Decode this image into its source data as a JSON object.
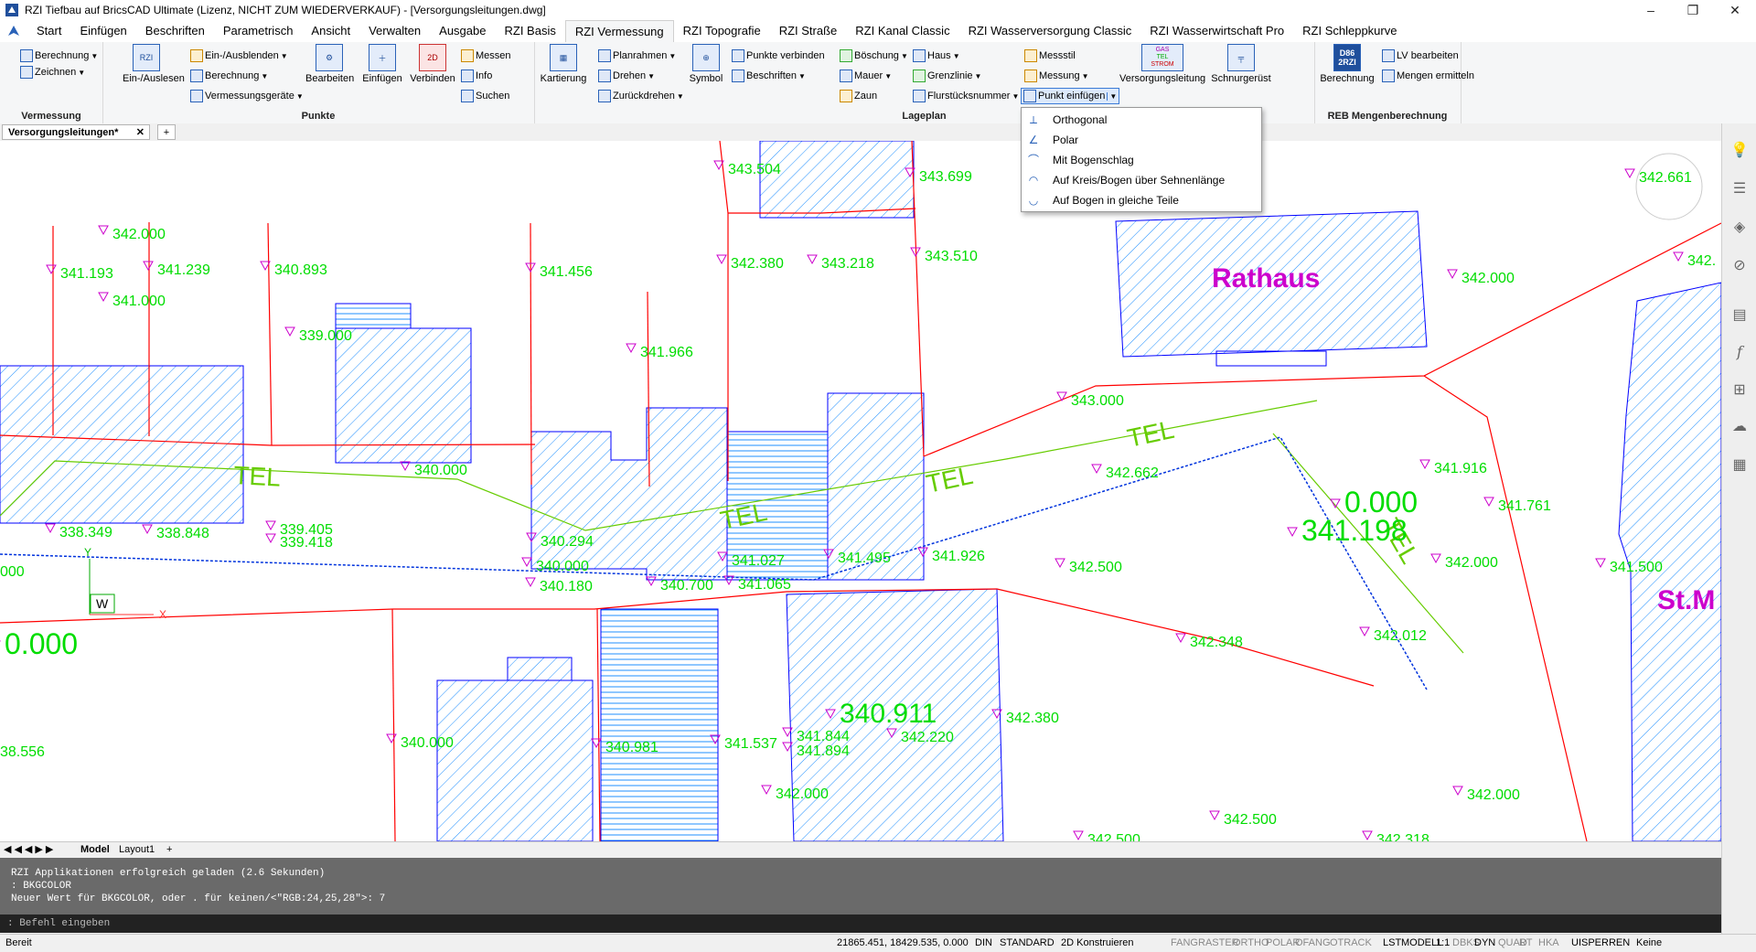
{
  "window": {
    "title": "RZI Tiefbau auf BricsCAD Ultimate (Lizenz, NICHT ZUM WIEDERVERKAUF) - [Versorgungsleitungen.dwg]",
    "minimize": "–",
    "restore": "❐",
    "close": "✕"
  },
  "ribbon_tabs": [
    "Start",
    "Einfügen",
    "Beschriften",
    "Parametrisch",
    "Ansicht",
    "Verwalten",
    "Ausgabe",
    "RZI Basis",
    "RZI Vermessung",
    "RZI Topografie",
    "RZI Straße",
    "RZI Kanal Classic",
    "RZI Wasserversorgung Classic",
    "RZI Wasserwirtschaft Pro",
    "RZI Schleppkurve"
  ],
  "active_tab": "RZI Vermessung",
  "ribbon": {
    "vermessung": {
      "label": "Vermessung",
      "berechnung": "Berechnung",
      "zeichnen": "Zeichnen"
    },
    "punkte": {
      "label": "Punkte",
      "ein_auslesen": "Ein-/Auslesen",
      "ein_ausblenden": "Ein-/Ausblenden",
      "berechnung": "Berechnung",
      "vermessungsgeraete": "Vermessungsgeräte",
      "bearbeiten": "Bearbeiten",
      "einfuegen": "Einfügen",
      "verbinden": "Verbinden",
      "messen": "Messen",
      "info": "Info",
      "suchen": "Suchen"
    },
    "lageplan": {
      "label": "Lageplan",
      "kartierung": "Kartierung",
      "planrahmen": "Planrahmen",
      "drehen": "Drehen",
      "zurueckdrehen": "Zurückdrehen",
      "symbol": "Symbol",
      "punkte_verbinden": "Punkte verbinden",
      "beschriften": "Beschriften",
      "boeschung": "Böschung",
      "mauer": "Mauer",
      "zaun": "Zaun",
      "haus": "Haus",
      "grenzlinie": "Grenzlinie",
      "flurstuecksnummer": "Flurstücksnummer",
      "messstil": "Messstil",
      "messung": "Messung",
      "punkt_einfuegen": "Punkt einfügen",
      "versorgungsleitung": "Versorgungsleitung",
      "schnurgeruest": "Schnurgerüst"
    },
    "reb": {
      "label": "REB Mengenberechnung",
      "berechnung": "Berechnung",
      "lv_bearbeiten": "LV bearbeiten",
      "mengen_ermitteln": "Mengen ermitteln",
      "icon_text": "D86 2RZI"
    },
    "icon_texts": {
      "rzi": "RZI",
      "gas": "GAS",
      "tel": "TEL",
      "strom": "STROM"
    }
  },
  "dropdown": {
    "items": [
      "Orthogonal",
      "Polar",
      "Mit Bogenschlag",
      "Auf Kreis/Bogen über Sehnenlänge",
      "Auf Bogen in gleiche Teile"
    ]
  },
  "document_tab": {
    "name": "Versorgungsleitungen*",
    "close": "✕",
    "add": "+"
  },
  "layout_tabs": {
    "model": "Model",
    "layout1": "Layout1",
    "add": "+"
  },
  "drawing": {
    "labels": [
      "343.504",
      "343.699",
      "342.000",
      "341.193",
      "341.239",
      "340.893",
      "341.000",
      "341.456",
      "342.380",
      "343.218",
      "343.510",
      "339.000",
      "341.966",
      "340.000",
      "338.349",
      "338.848",
      "339.405",
      "339.418",
      "340.294",
      "340.000",
      "340.180",
      "340.700",
      "341.027",
      "341.495",
      "341.926",
      "341.065",
      "342.662",
      "343.000",
      "341.916",
      "341.761",
      "342.000",
      "342.661",
      "342.500",
      "341.198",
      "0.000",
      "342.348",
      "342.012",
      "340.911",
      "342.380",
      "341.844",
      "341.894",
      "342.220",
      "341.537",
      "340.981",
      "340.000",
      "342.000",
      "342.500",
      "342.500",
      "342.000",
      "341.500",
      "342.000",
      "000",
      "0.000",
      "38.556",
      "342.318",
      "342."
    ],
    "text_labels": {
      "rathaus": "Rathaus",
      "stm": "St.M",
      "tel": "TEL",
      "ucs_x": "X",
      "ucs_y": "Y",
      "ucs_w": "W"
    }
  },
  "command_line": {
    "lines": [
      "RZI Applikationen erfolgreich geladen (2.6 Sekunden)",
      ": BKGCOLOR",
      "Neuer Wert für BKGCOLOR, oder . für keinen/<\"RGB:24,25,28\">: 7"
    ],
    "input_placeholder": ": Befehl eingeben"
  },
  "status_bar": {
    "ready": "Bereit",
    "coords": "21865.451, 18429.535, 0.000",
    "items": [
      "DIN",
      "STANDARD",
      "2D Konstruieren",
      "FANG",
      "RASTER",
      "ORTHO",
      "POLAR",
      "OFANG",
      "OTRACK",
      "LST",
      "MODELL",
      "1:1",
      "DBKS",
      "DYN",
      "QUAD",
      "RT",
      "HKA",
      "UISPERREN",
      "Keine"
    ]
  }
}
